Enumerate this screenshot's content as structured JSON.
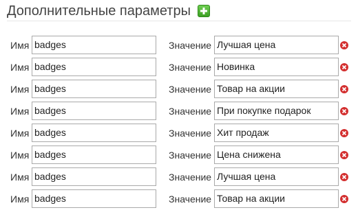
{
  "header": {
    "title": "Дополнительные параметры",
    "add_icon": "plus-icon",
    "add_color": "#3c9e23"
  },
  "labels": {
    "name": "Имя",
    "value": "Значение"
  },
  "delete_icon": "remove-icon",
  "delete_color": "#d32f2f",
  "rows": [
    {
      "name": "badges",
      "value": "Лучшая цена"
    },
    {
      "name": "badges",
      "value": "Новинка"
    },
    {
      "name": "badges",
      "value": "Товар на акции"
    },
    {
      "name": "badges",
      "value": "При покупке подарок"
    },
    {
      "name": "badges",
      "value": "Хит продаж"
    },
    {
      "name": "badges",
      "value": "Цена снижена"
    },
    {
      "name": "badges",
      "value": "Лучшая цена"
    },
    {
      "name": "badges",
      "value": "Товар на акции"
    }
  ]
}
